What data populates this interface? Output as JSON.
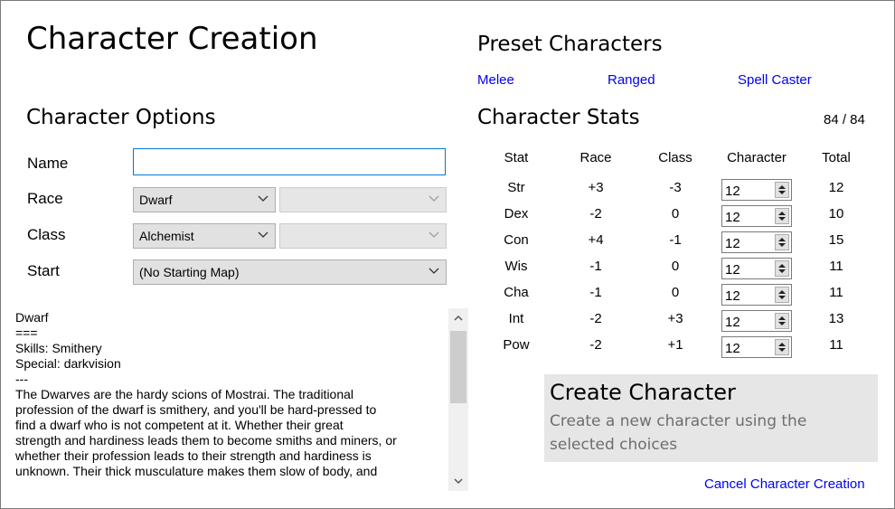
{
  "title": "Character Creation",
  "preset": {
    "heading": "Preset Characters",
    "links": [
      "Melee",
      "Ranged",
      "Spell Caster"
    ]
  },
  "options": {
    "heading": "Character Options",
    "name_label": "Name",
    "name_value": "",
    "race_label": "Race",
    "race_value": "Dwarf",
    "class_label": "Class",
    "class_value": "Alchemist",
    "start_label": "Start",
    "start_value": "(No Starting Map)"
  },
  "description": [
    "Dwarf",
    "===",
    "Skills: Smithery",
    "Special: darkvision",
    "---",
    "The Dwarves are the hardy scions of Mostrai. The traditional",
    "profession of the dwarf is smithery, and you'll be hard-pressed to",
    "find a dwarf who is not competent at it. Whether their great",
    "strength and hardiness leads them to become smiths and miners, or",
    "whether their profession leads to their strength and hardiness is",
    "unknown. Their thick musculature makes them slow of body, and"
  ],
  "stats": {
    "heading": "Character Stats",
    "points": "84 / 84",
    "columns": [
      "Stat",
      "Race",
      "Class",
      "Character",
      "Total"
    ],
    "rows": [
      {
        "stat": "Str",
        "race": "+3",
        "class": "-3",
        "character": "12",
        "total": "12"
      },
      {
        "stat": "Dex",
        "race": "-2",
        "class": "0",
        "character": "12",
        "total": "10"
      },
      {
        "stat": "Con",
        "race": "+4",
        "class": "-1",
        "character": "12",
        "total": "15"
      },
      {
        "stat": "Wis",
        "race": "-1",
        "class": "0",
        "character": "12",
        "total": "11"
      },
      {
        "stat": "Cha",
        "race": "-1",
        "class": "0",
        "character": "12",
        "total": "11"
      },
      {
        "stat": "Int",
        "race": "-2",
        "class": "+3",
        "character": "12",
        "total": "13"
      },
      {
        "stat": "Pow",
        "race": "-2",
        "class": "+1",
        "character": "12",
        "total": "11"
      }
    ]
  },
  "create": {
    "title": "Create Character",
    "subtitle": "Create a new character using the selected choices"
  },
  "cancel_label": "Cancel Character Creation",
  "icons": {
    "dropdown": "chevron-down-icon",
    "scroll_up": "chevron-up-icon",
    "scroll_down": "chevron-down-icon",
    "spin": "spin-arrows-icon"
  }
}
